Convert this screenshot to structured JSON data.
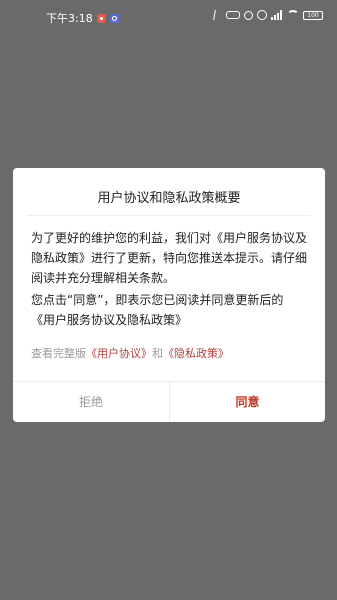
{
  "status_bar": {
    "time": "下午3:18",
    "battery": "100",
    "icons": [
      "notification-icon",
      "app-icon",
      "bluetooth-icon",
      "hd-icon",
      "mute-icon",
      "alarm-icon",
      "signal-icon",
      "wifi-icon",
      "battery-icon"
    ]
  },
  "dialog": {
    "title": "用户协议和隐私政策概要",
    "para1": "为了更好的维护您的利益，我们对《用户服务协议及隐私政策》进行了更新，特向您推送本提示。请仔细阅读并充分理解相关条款。",
    "para2": "您点击“同意”，即表示您已阅读并同意更新后的 《用户服务协议及隐私政策》",
    "view_full_prefix": "查看完整版",
    "user_agreement_link": "《用户协议》",
    "and_text": "和",
    "privacy_policy_link": "《隐私政策》",
    "reject_label": "拒绝",
    "agree_label": "同意"
  },
  "colors": {
    "overlay": "#6a6a6a",
    "link": "#b0413e",
    "agree": "#c0392b"
  }
}
